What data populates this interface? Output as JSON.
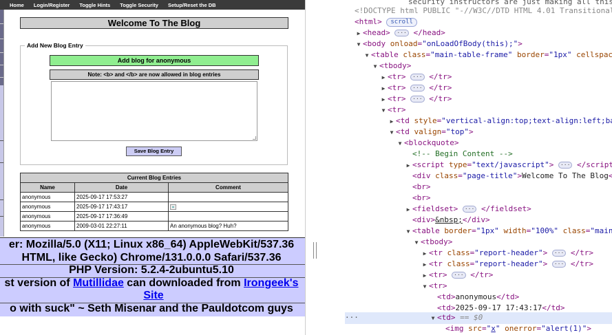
{
  "nav": [
    "Home",
    "Login/Register",
    "Toggle Hints",
    "Toggle Security",
    "Setup/Reset the DB"
  ],
  "page_title": "Welcome To The Blog",
  "form": {
    "legend": "Add New Blog Entry",
    "header": "Add blog for anonymous",
    "note": "Note: <b> and </b> are now allowed in blog entries",
    "textarea_value": "",
    "save_label": "Save Blog Entry"
  },
  "entries": {
    "caption": "Current Blog Entries",
    "columns": [
      "Name",
      "Date",
      "Comment"
    ],
    "rows": [
      {
        "name": "anonymous",
        "date": "2025-09-17 17:53:27",
        "comment": ""
      },
      {
        "name": "anonymous",
        "date": "2025-09-17 17:43:17",
        "comment": "",
        "broken_image": true
      },
      {
        "name": "anonymous",
        "date": "2025-09-17 17:36:49",
        "comment": ""
      },
      {
        "name": "anonymous",
        "date": "2009-03-01 22:27:11",
        "comment": "An anonymous blog? Huh?"
      }
    ]
  },
  "footer": {
    "agent_line1": "er: Mozilla/5.0 (X11; Linux x86_64) AppleWebKit/537.36",
    "agent_line2": "HTML, like Gecko) Chrome/131.0.0.0 Safari/537.36",
    "php_version": "PHP Version: 5.2.4-2ubuntu5.10",
    "latest_prefix": "st version of ",
    "mutillidae_link": "Mutillidae",
    "latest_middle": " can downloaded from ",
    "irongeek_link_1": "Irongeek's",
    "irongeek_link_2": "Site",
    "quote": "o with suck\" ~ Seth Misenar and the Pauldotcom guys"
  },
  "devtools": {
    "top_text": "security instructors are just making all this",
    "doctype": "<!DOCTYPE html PUBLIC \"-//W3C//DTD HTML 4.01 Transitional",
    "scroll_badge": "scroll",
    "title_text": "Welcome To The Blog",
    "nbsp": "&nbsp;",
    "td_anonymous": "anonymous",
    "td_date": "2025-09-17 17:43:17",
    "selected_marker": "== $0",
    "img_src": "x",
    "img_onerror": "alert(1)",
    "comment": "<!-- Begin Content -->",
    "body_onload": "onLoadOfBody(this);",
    "table_class": "main-table-frame",
    "td_style": "vertical-align:top;text-align:left;ba",
    "script_type": "text/javascript",
    "div_class": "page-title",
    "table2_class": "main",
    "tr_class": "report-header"
  }
}
